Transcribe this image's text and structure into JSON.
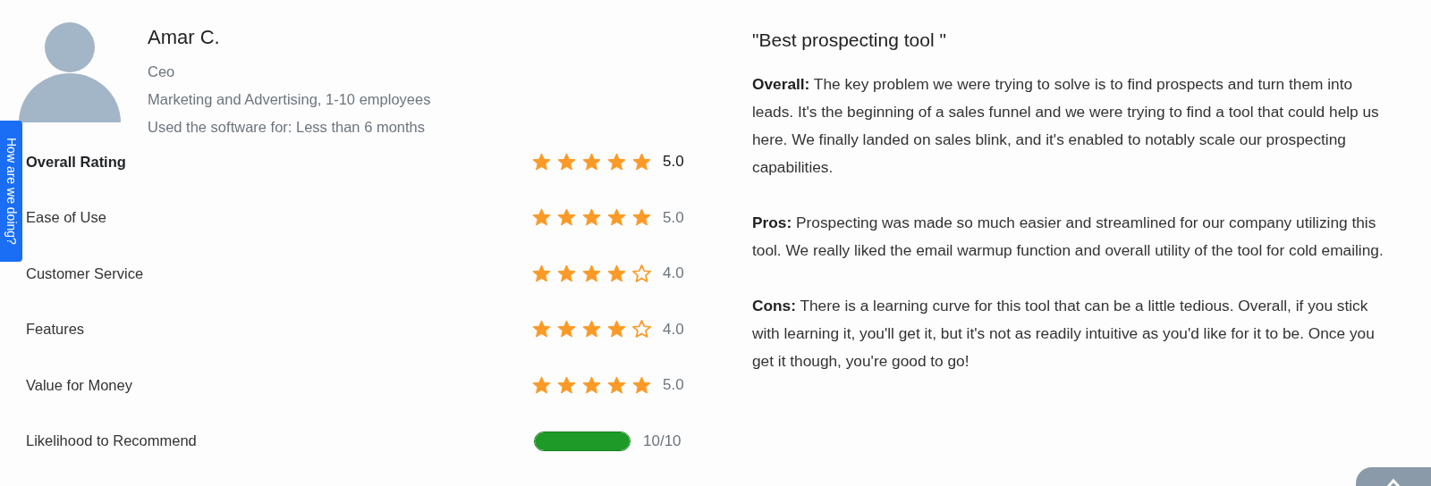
{
  "reviewer": {
    "name": "Amar C.",
    "role": "Ceo",
    "company": "Marketing and Advertising, 1-10 employees",
    "usage": "Used the software for: Less than 6 months"
  },
  "ratings": [
    {
      "kind": "overall",
      "label": "Overall Rating",
      "stars": 5,
      "value": "5.0"
    },
    {
      "kind": "stars",
      "label": "Ease of Use",
      "stars": 5,
      "value": "5.0"
    },
    {
      "kind": "stars",
      "label": "Customer Service",
      "stars": 4,
      "value": "4.0"
    },
    {
      "kind": "stars",
      "label": "Features",
      "stars": 4,
      "value": "4.0"
    },
    {
      "kind": "stars",
      "label": "Value for Money",
      "stars": 5,
      "value": "5.0"
    },
    {
      "kind": "bar",
      "label": "Likelihood to Recommend",
      "level": 1,
      "value": "10/10"
    }
  ],
  "review": {
    "title": "\"Best prospecting tool \"",
    "sections": [
      "**Overall:** The key problem we were trying to solve is to find prospects and turn them into leads. It's the beginning of a sales funnel and we were trying to find a tool that could help us here. We finally landed on sales blink, and it's enabled to notably scale our prospecting capabilities.",
      "**Pros:** Prospecting was made so much easier and streamlined for our company utilizing this tool. We really liked the email warmup function and overall utility of the tool for cold emailing.",
      "**Cons:** There is a learning curve for this tool that can be a little tedious. Overall, if you stick with learning it, you'll get it, but it's not as readily intuitive as you'd like for it to be. Once you get it though, you're good to go!"
    ]
  },
  "feedback_tab": {
    "label": "How are we doing?"
  }
}
